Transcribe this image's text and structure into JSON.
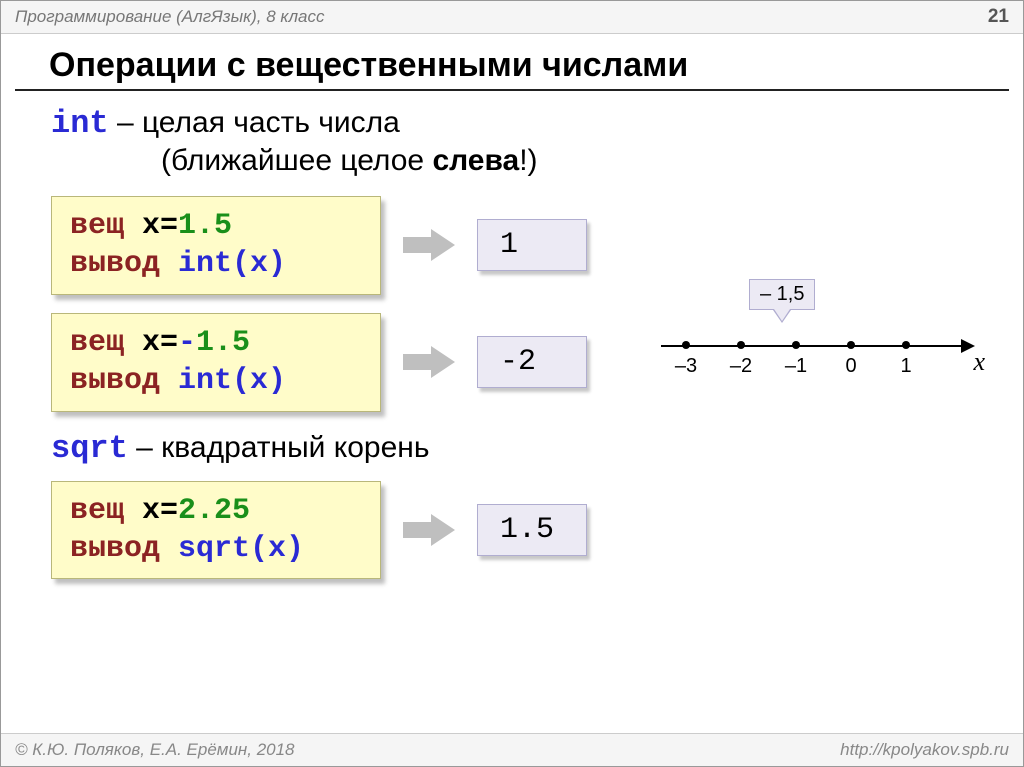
{
  "header": {
    "breadcrumb": "Программирование (АлгЯзык), 8 класс",
    "page_number": "21"
  },
  "title": "Операции с вещественными числами",
  "intro": {
    "keyword": "int",
    "line1_rest": " – целая часть числа",
    "line2_pre": "(ближайшее целое ",
    "line2_bold": "слева",
    "line2_post": "!)"
  },
  "examples": [
    {
      "code": {
        "l1_kw": "вещ",
        "l1_rest_a": " x=",
        "l1_num": "1.5",
        "l2_kw": "вывод ",
        "l2_func": "int(x)"
      },
      "result": "1"
    },
    {
      "code": {
        "l1_kw": "вещ",
        "l1_rest_a": " x=",
        "l1_neg": "-",
        "l1_num": "1.5",
        "l2_kw": "вывод ",
        "l2_func": "int(x)"
      },
      "result": "-2"
    }
  ],
  "sqrt_label": {
    "keyword": "sqrt",
    "rest": " – квадратный корень"
  },
  "example3": {
    "code": {
      "l1_kw": "вещ",
      "l1_rest_a": " x=",
      "l1_num": "2.25",
      "l2_kw": "вывод ",
      "l2_func": "sqrt(x)"
    },
    "result": "1.5"
  },
  "numline": {
    "callout_label": "– 1,5",
    "ticks": [
      "–3",
      "–2",
      "–1",
      "0",
      "1"
    ],
    "axis_var": "x"
  },
  "footer": {
    "left": "© К.Ю. Поляков, Е.А. Ерёмин, 2018",
    "right": "http://kpolyakov.spb.ru"
  }
}
